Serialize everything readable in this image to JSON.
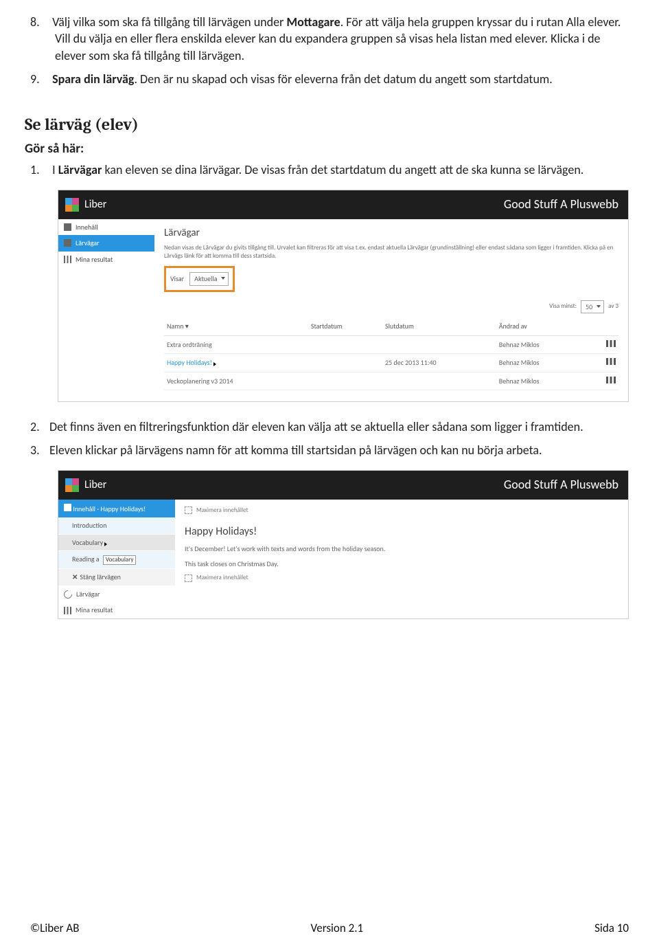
{
  "doc": {
    "items_a": [
      {
        "pre": "Välj vilka som ska få tillgång till lärvägen under ",
        "b1": "Mottagare",
        "mid": ". För att välja hela gruppen kryssar du i rutan  Alla elever. Vill du välja en eller flera enskilda elever kan du expandera gruppen så visas hela listan med elever. Klicka i de elever som ska få tillgång till lärvägen."
      },
      {
        "b1": "Spara din lärväg",
        "mid": ". Den är nu skapad och visas för eleverna från det datum du angett som startdatum."
      }
    ],
    "section_title": "Se lärväg (elev)",
    "subheading": "Gör så här:",
    "items_b": [
      {
        "pre": "I ",
        "b1": "Lärvägar",
        "mid": " kan eleven se dina lärvägar. De visas från det startdatum du angett att de ska kunna se lärvägen."
      },
      {
        "txt": "Det finns även en filtreringsfunktion där eleven kan välja att se aktuella eller sådana som ligger i framtiden."
      },
      {
        "txt": "Eleven klickar på lärvägens namn för att komma till startsidan på lärvägen och kan nu börja arbeta."
      }
    ]
  },
  "brand": {
    "name": "Liber",
    "product": "Good Stuff A Pluswebb"
  },
  "shot1": {
    "sidebar": {
      "i0": "Innehåll",
      "i1": "Lärvägar",
      "i2": "Mina resultat"
    },
    "title": "Lärvägar",
    "desc": "Nedan visas de Lärvägar du givits tillgång till. Urvalet kan filtreras för att visa t.ex. endast aktuella Lärvägar (grundinställning) eller endast sådana som ligger i framtiden. Klicka på en Lärvägs länk för att komma till dess startsida.",
    "filter_label": "Visar",
    "filter_value": "Aktuella",
    "show_label": "Visa minst:",
    "show_value": "50",
    "show_tail": "av 3",
    "cols": {
      "c0": "Namn ▾",
      "c1": "Startdatum",
      "c2": "Slutdatum",
      "c3": "Ändrad av"
    },
    "rows": [
      {
        "name": "Extra ordträning",
        "start": "",
        "end": "",
        "by": "Behnaz Miklos"
      },
      {
        "name": "Happy Holidays!",
        "start": "",
        "end": "25 dec 2013 11:40",
        "by": "Behnaz Miklos"
      },
      {
        "name": "Veckoplanering v3 2014",
        "start": "",
        "end": "",
        "by": "Behnaz Miklos"
      }
    ]
  },
  "shot2": {
    "head": "Innehåll - Happy Holidays!",
    "items": {
      "i0": "Introduction",
      "i1": "Vocabulary",
      "i2_pre": "Reading a",
      "i2_tip": "Vocabulary",
      "i3": "Stäng lärvägen",
      "i4": "Lärvägar",
      "i5": "Mina resultat"
    },
    "max": "Maximera innehållet",
    "title": "Happy Holidays!",
    "line1": "It's December! Let's work with texts and words from the holiday season.",
    "line2": "This task closes on Christmas Day."
  },
  "footer": {
    "left": "©Liber AB",
    "mid": "Version 2.1",
    "right": "Sida 10"
  }
}
